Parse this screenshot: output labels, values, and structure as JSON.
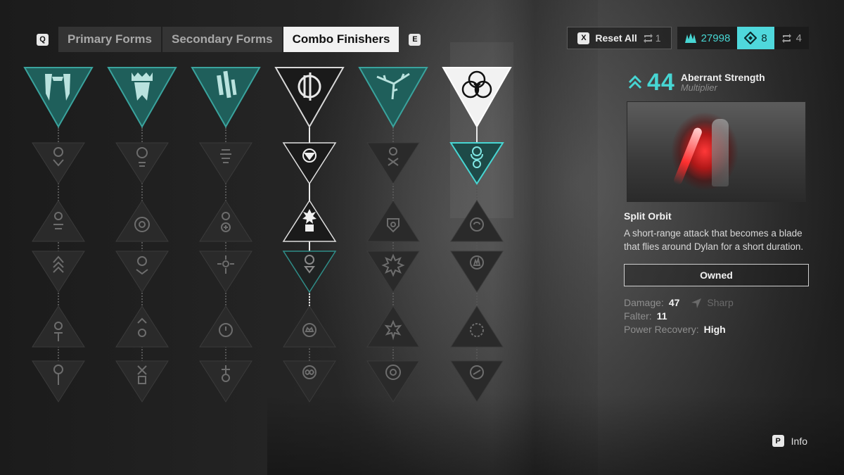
{
  "tabs": {
    "prev_key": "Q",
    "next_key": "E",
    "items": [
      {
        "label": "Primary Forms",
        "active": false
      },
      {
        "label": "Secondary Forms",
        "active": false
      },
      {
        "label": "Combo Finishers",
        "active": true
      }
    ]
  },
  "topbar": {
    "reset_key": "X",
    "reset_label": "Reset All",
    "reset_count": "1",
    "shards": "27998",
    "tokens": "8",
    "rerolls": "4"
  },
  "tree": {
    "columns": [
      {
        "name": "column-1",
        "top_state": "teal",
        "icon": "twin-fangs-icon"
      },
      {
        "name": "column-2",
        "top_state": "teal",
        "icon": "crown-banner-icon"
      },
      {
        "name": "column-3",
        "top_state": "teal",
        "icon": "blade-bars-icon"
      },
      {
        "name": "column-4",
        "top_state": "white",
        "icon": "slash-disc-icon"
      },
      {
        "name": "column-5",
        "top_state": "teal",
        "icon": "thorn-branch-icon"
      },
      {
        "name": "column-6",
        "top_state": "selected",
        "icon": "triquetra-orbit-icon"
      }
    ]
  },
  "panel": {
    "rank": "44",
    "rank_name": "Aberrant Strength",
    "rank_type": "Multiplier",
    "ability_name": "Split Orbit",
    "ability_desc": "A short-range attack that becomes a blade that flies around Dylan for a short duration.",
    "owned_label": "Owned",
    "stats": {
      "damage_label": "Damage:",
      "damage_value": "47",
      "damage_type": "Sharp",
      "falter_label": "Falter:",
      "falter_value": "11",
      "recovery_label": "Power Recovery:",
      "recovery_value": "High"
    }
  },
  "footer": {
    "info_key": "P",
    "info_label": "Info"
  },
  "colors": {
    "accent": "#47d6d3",
    "teal_node": "#1f5f5b",
    "active_tab": "#f2f2f2"
  }
}
